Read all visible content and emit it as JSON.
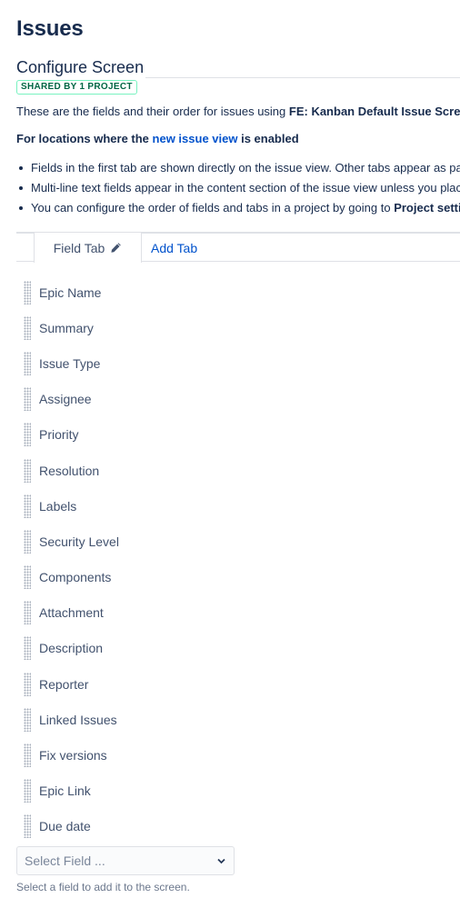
{
  "page": {
    "title": "Issues"
  },
  "screen": {
    "title": "Configure Screen",
    "badge": "SHARED BY 1 PROJECT",
    "intro_prefix": "These are the fields and their order for issues using ",
    "intro_screen_name": "FE: Kanban Default Issue Screen",
    "intro_suffix": " ."
  },
  "locations": {
    "prefix": "For locations where the ",
    "link": "new issue view",
    "suffix": " is enabled"
  },
  "bullets": [
    {
      "text": "Fields in the first tab are shown directly on the issue view. Other tabs appear as pane"
    },
    {
      "text": "Multi-line text fields appear in the content section of the issue view unless you place"
    },
    {
      "text_prefix": "You can configure the order of fields and tabs in a project by going to ",
      "text_bold": "Project settir"
    }
  ],
  "tabs": {
    "field_tab": "Field Tab",
    "add_tab": "Add Tab",
    "icons": {
      "edit": "pencil-icon"
    }
  },
  "fields": [
    "Epic Name",
    "Summary",
    "Issue Type",
    "Assignee",
    "Priority",
    "Resolution",
    "Labels",
    "Security Level",
    "Components",
    "Attachment",
    "Description",
    "Reporter",
    "Linked Issues",
    "Fix versions",
    "Epic Link",
    "Due date"
  ],
  "select": {
    "placeholder": "Select Field ...",
    "helper": "Select a field to add it to the screen."
  },
  "colors": {
    "link": "#0052cc",
    "badge_text": "#006644",
    "badge_border": "#79f2c0",
    "text": "#172b4d"
  }
}
